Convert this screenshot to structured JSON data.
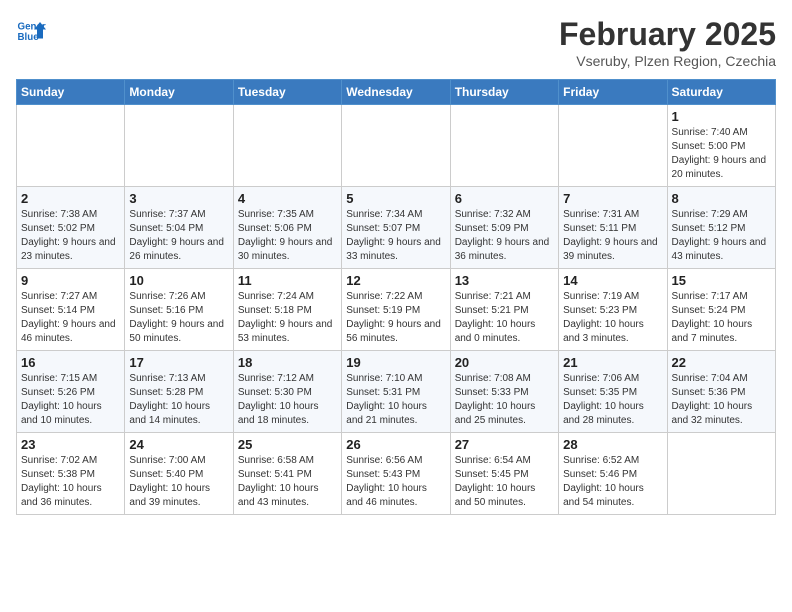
{
  "header": {
    "logo_line1": "General",
    "logo_line2": "Blue",
    "month": "February 2025",
    "location": "Vseruby, Plzen Region, Czechia"
  },
  "weekdays": [
    "Sunday",
    "Monday",
    "Tuesday",
    "Wednesday",
    "Thursday",
    "Friday",
    "Saturday"
  ],
  "weeks": [
    [
      {
        "day": "",
        "info": ""
      },
      {
        "day": "",
        "info": ""
      },
      {
        "day": "",
        "info": ""
      },
      {
        "day": "",
        "info": ""
      },
      {
        "day": "",
        "info": ""
      },
      {
        "day": "",
        "info": ""
      },
      {
        "day": "1",
        "info": "Sunrise: 7:40 AM\nSunset: 5:00 PM\nDaylight: 9 hours and 20 minutes."
      }
    ],
    [
      {
        "day": "2",
        "info": "Sunrise: 7:38 AM\nSunset: 5:02 PM\nDaylight: 9 hours and 23 minutes."
      },
      {
        "day": "3",
        "info": "Sunrise: 7:37 AM\nSunset: 5:04 PM\nDaylight: 9 hours and 26 minutes."
      },
      {
        "day": "4",
        "info": "Sunrise: 7:35 AM\nSunset: 5:06 PM\nDaylight: 9 hours and 30 minutes."
      },
      {
        "day": "5",
        "info": "Sunrise: 7:34 AM\nSunset: 5:07 PM\nDaylight: 9 hours and 33 minutes."
      },
      {
        "day": "6",
        "info": "Sunrise: 7:32 AM\nSunset: 5:09 PM\nDaylight: 9 hours and 36 minutes."
      },
      {
        "day": "7",
        "info": "Sunrise: 7:31 AM\nSunset: 5:11 PM\nDaylight: 9 hours and 39 minutes."
      },
      {
        "day": "8",
        "info": "Sunrise: 7:29 AM\nSunset: 5:12 PM\nDaylight: 9 hours and 43 minutes."
      }
    ],
    [
      {
        "day": "9",
        "info": "Sunrise: 7:27 AM\nSunset: 5:14 PM\nDaylight: 9 hours and 46 minutes."
      },
      {
        "day": "10",
        "info": "Sunrise: 7:26 AM\nSunset: 5:16 PM\nDaylight: 9 hours and 50 minutes."
      },
      {
        "day": "11",
        "info": "Sunrise: 7:24 AM\nSunset: 5:18 PM\nDaylight: 9 hours and 53 minutes."
      },
      {
        "day": "12",
        "info": "Sunrise: 7:22 AM\nSunset: 5:19 PM\nDaylight: 9 hours and 56 minutes."
      },
      {
        "day": "13",
        "info": "Sunrise: 7:21 AM\nSunset: 5:21 PM\nDaylight: 10 hours and 0 minutes."
      },
      {
        "day": "14",
        "info": "Sunrise: 7:19 AM\nSunset: 5:23 PM\nDaylight: 10 hours and 3 minutes."
      },
      {
        "day": "15",
        "info": "Sunrise: 7:17 AM\nSunset: 5:24 PM\nDaylight: 10 hours and 7 minutes."
      }
    ],
    [
      {
        "day": "16",
        "info": "Sunrise: 7:15 AM\nSunset: 5:26 PM\nDaylight: 10 hours and 10 minutes."
      },
      {
        "day": "17",
        "info": "Sunrise: 7:13 AM\nSunset: 5:28 PM\nDaylight: 10 hours and 14 minutes."
      },
      {
        "day": "18",
        "info": "Sunrise: 7:12 AM\nSunset: 5:30 PM\nDaylight: 10 hours and 18 minutes."
      },
      {
        "day": "19",
        "info": "Sunrise: 7:10 AM\nSunset: 5:31 PM\nDaylight: 10 hours and 21 minutes."
      },
      {
        "day": "20",
        "info": "Sunrise: 7:08 AM\nSunset: 5:33 PM\nDaylight: 10 hours and 25 minutes."
      },
      {
        "day": "21",
        "info": "Sunrise: 7:06 AM\nSunset: 5:35 PM\nDaylight: 10 hours and 28 minutes."
      },
      {
        "day": "22",
        "info": "Sunrise: 7:04 AM\nSunset: 5:36 PM\nDaylight: 10 hours and 32 minutes."
      }
    ],
    [
      {
        "day": "23",
        "info": "Sunrise: 7:02 AM\nSunset: 5:38 PM\nDaylight: 10 hours and 36 minutes."
      },
      {
        "day": "24",
        "info": "Sunrise: 7:00 AM\nSunset: 5:40 PM\nDaylight: 10 hours and 39 minutes."
      },
      {
        "day": "25",
        "info": "Sunrise: 6:58 AM\nSunset: 5:41 PM\nDaylight: 10 hours and 43 minutes."
      },
      {
        "day": "26",
        "info": "Sunrise: 6:56 AM\nSunset: 5:43 PM\nDaylight: 10 hours and 46 minutes."
      },
      {
        "day": "27",
        "info": "Sunrise: 6:54 AM\nSunset: 5:45 PM\nDaylight: 10 hours and 50 minutes."
      },
      {
        "day": "28",
        "info": "Sunrise: 6:52 AM\nSunset: 5:46 PM\nDaylight: 10 hours and 54 minutes."
      },
      {
        "day": "",
        "info": ""
      }
    ]
  ]
}
